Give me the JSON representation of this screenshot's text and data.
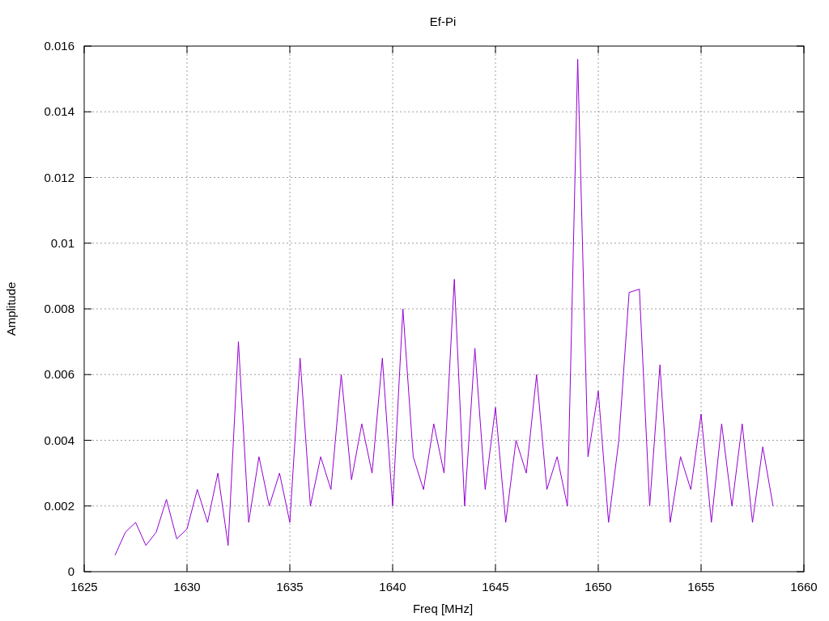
{
  "chart_data": {
    "type": "line",
    "title": "Ef-Pi",
    "xlabel": "Freq [MHz]",
    "ylabel": "Amplitude",
    "grid": true,
    "xlim": [
      1625,
      1660
    ],
    "ylim": [
      0,
      0.016
    ],
    "xticks": [
      1625,
      1630,
      1635,
      1640,
      1645,
      1650,
      1655,
      1660
    ],
    "yticks": [
      {
        "value": 0,
        "label": "0"
      },
      {
        "value": 0.002,
        "label": "0.002"
      },
      {
        "value": 0.004,
        "label": "0.004"
      },
      {
        "value": 0.006,
        "label": "0.006"
      },
      {
        "value": 0.008,
        "label": "0.008"
      },
      {
        "value": 0.01,
        "label": "0.01"
      },
      {
        "value": 0.012,
        "label": "0.012"
      },
      {
        "value": 0.014,
        "label": "0.014"
      },
      {
        "value": 0.016,
        "label": "0.016"
      }
    ],
    "x": [
      1626.5,
      1627,
      1627.5,
      1628,
      1628.5,
      1629,
      1629.5,
      1630,
      1630.5,
      1631,
      1631.5,
      1632,
      1632.5,
      1633,
      1633.5,
      1634,
      1634.5,
      1635,
      1635.5,
      1636,
      1636.5,
      1637,
      1637.5,
      1638,
      1638.5,
      1639,
      1639.5,
      1640,
      1640.5,
      1641,
      1641.5,
      1642,
      1642.5,
      1643,
      1643.5,
      1644,
      1644.5,
      1645,
      1645.5,
      1646,
      1646.5,
      1647,
      1647.5,
      1648,
      1648.5,
      1649,
      1649.5,
      1650,
      1650.5,
      1651,
      1651.5,
      1652,
      1652.5,
      1653,
      1653.5,
      1654,
      1654.5,
      1655,
      1655.5,
      1656,
      1656.5,
      1657,
      1657.5,
      1658,
      1658.5
    ],
    "series": [
      {
        "color": "#9400d3",
        "values": [
          0.0005,
          0.0012,
          0.0015,
          0.0008,
          0.0012,
          0.0022,
          0.001,
          0.0013,
          0.0025,
          0.0015,
          0.003,
          0.0008,
          0.007,
          0.0015,
          0.0035,
          0.002,
          0.003,
          0.0015,
          0.0065,
          0.002,
          0.0035,
          0.0025,
          0.006,
          0.0028,
          0.0045,
          0.003,
          0.0065,
          0.002,
          0.008,
          0.0035,
          0.0025,
          0.0045,
          0.003,
          0.0089,
          0.002,
          0.0068,
          0.0025,
          0.005,
          0.0015,
          0.004,
          0.003,
          0.006,
          0.0025,
          0.0035,
          0.002,
          0.0156,
          0.0035,
          0.0055,
          0.0015,
          0.004,
          0.0085,
          0.0086,
          0.002,
          0.0063,
          0.0015,
          0.0035,
          0.0025,
          0.0048,
          0.0015,
          0.0045,
          0.002,
          0.0045,
          0.0015,
          0.0038,
          0.002
        ]
      }
    ]
  }
}
